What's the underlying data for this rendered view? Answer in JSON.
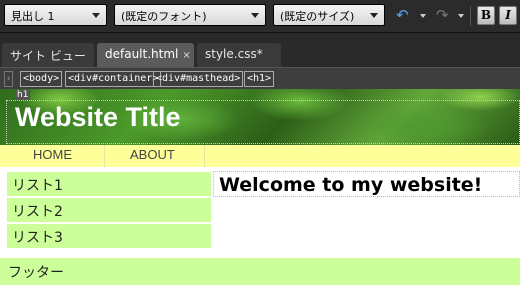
{
  "toolbar": {
    "format_value": "見出し 1",
    "font_value": "(既定のフォント)",
    "size_value": "(既定のサイズ)",
    "bold_label": "B",
    "italic_label": "I"
  },
  "tabs": [
    {
      "label": "サイト ビュー"
    },
    {
      "label": "default.html",
      "close": "×"
    },
    {
      "label": "style.css*"
    }
  ],
  "tags": [
    "<body>",
    "<div#container>",
    "<div#masthead>",
    "<h1>"
  ],
  "page": {
    "h1_badge": "h1",
    "site_title": "Website Title",
    "nav": [
      "HOME",
      "ABOUT"
    ],
    "sidebar": [
      "リスト1",
      "リスト2",
      "リスト3"
    ],
    "main_heading": "Welcome to my website!",
    "footer": "フッター"
  },
  "colors": {
    "nav_bg": "#ffff99",
    "sidebar_bg": "#ccff99",
    "footer_bg": "#ccff99",
    "undo_accent": "#5aa0f0"
  }
}
